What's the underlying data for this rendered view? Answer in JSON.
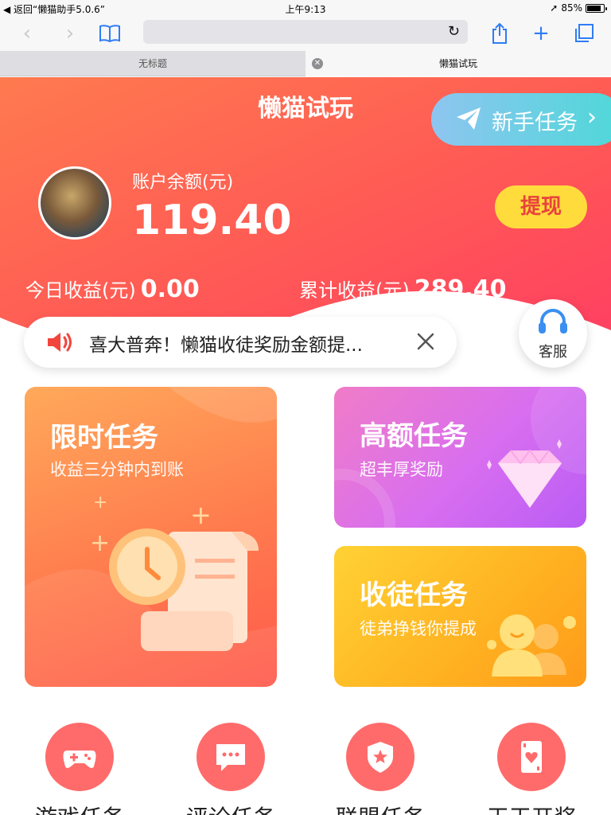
{
  "status_bar": {
    "back_app": "返回“懒猫助手5.0.6”",
    "time": "上午9:13",
    "battery": "85%",
    "battery_level": 0.85
  },
  "browser": {
    "tabs": [
      {
        "label": "无标题",
        "active": false
      },
      {
        "label": "懒猫试玩",
        "active": true
      }
    ],
    "url": ""
  },
  "header": {
    "title": "懒猫试玩",
    "newbie_button": "新手任务",
    "balance_label": "账户余额(元)",
    "balance_value": "119.40",
    "withdraw_button": "提现",
    "today_label": "今日收益(元)",
    "today_value": "0.00",
    "total_label": "累计收益(元)",
    "total_value": "289.40",
    "accent_color": "#ff5a55"
  },
  "notice": {
    "message": "喜大普奔！懒猫收徒奖励金额提...",
    "service_label": "客服"
  },
  "cards": [
    {
      "title": "限时任务",
      "subtitle": "收益三分钟内到账",
      "icon": "clock-scroll-icon"
    },
    {
      "title": "高额任务",
      "subtitle": "超丰厚奖励",
      "icon": "diamond-icon"
    },
    {
      "title": "收徒任务",
      "subtitle": "徒弟挣钱你提成",
      "icon": "people-icon"
    }
  ],
  "nav": [
    {
      "label": "游戏任务",
      "icon": "gamepad-icon"
    },
    {
      "label": "评论任务",
      "icon": "comment-icon"
    },
    {
      "label": "联盟任务",
      "icon": "shield-star-icon"
    },
    {
      "label": "天天开奖",
      "icon": "playing-card-icon"
    }
  ]
}
